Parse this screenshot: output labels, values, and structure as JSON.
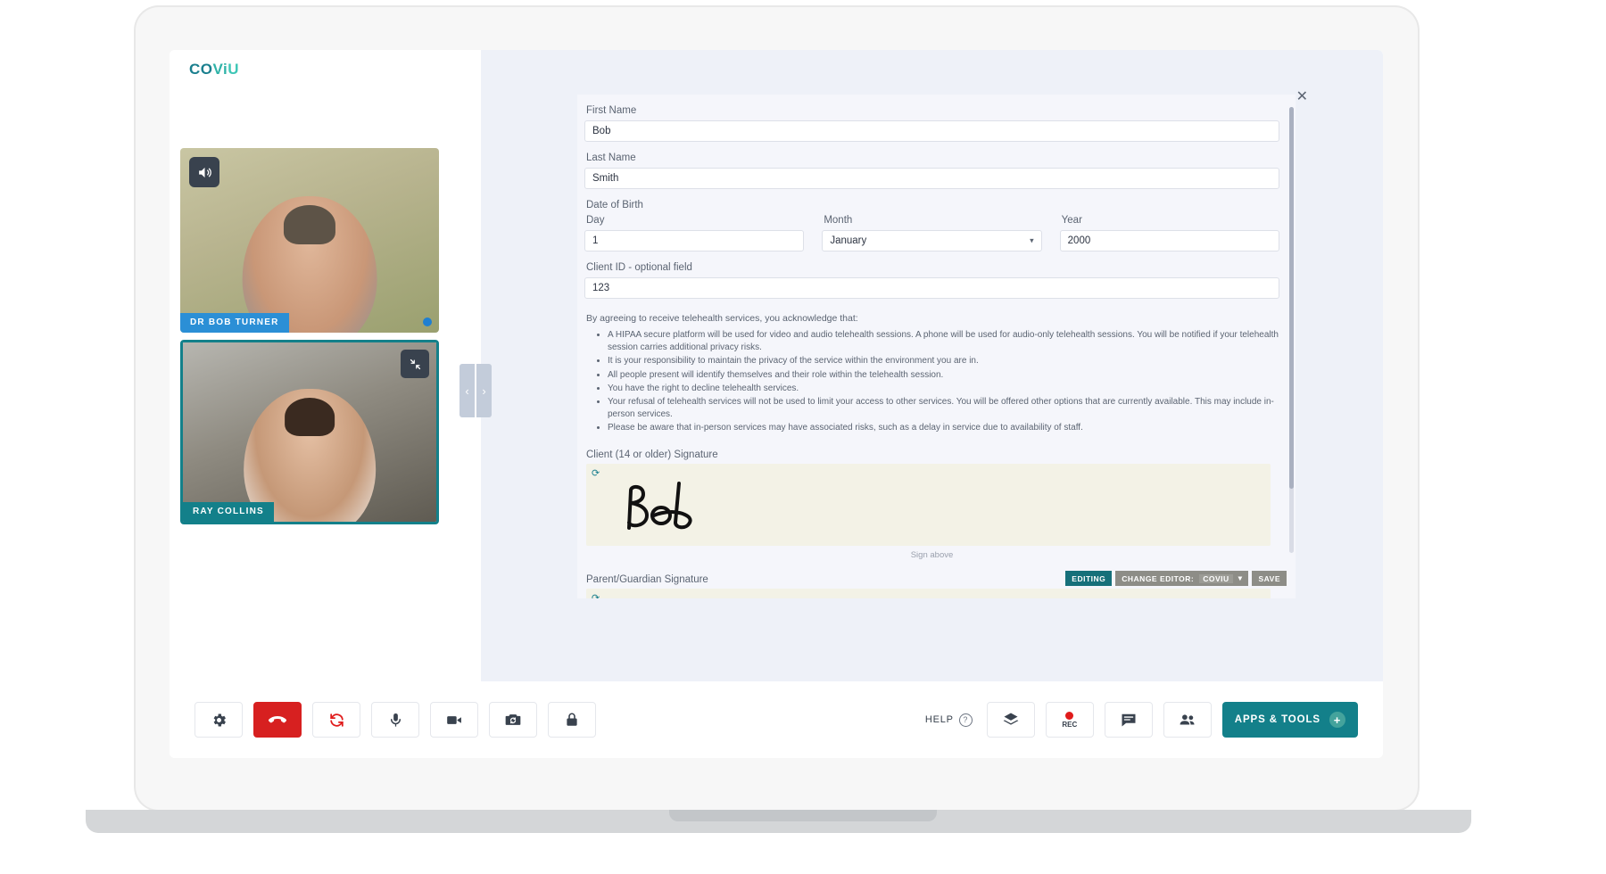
{
  "app": {
    "logo": {
      "part1": "CO",
      "part2": "Vi",
      "part3": "U"
    }
  },
  "video": {
    "remote": {
      "name": "DR BOB TURNER",
      "speaker_icon": "speaker-icon"
    },
    "local": {
      "name": "RAY COLLINS",
      "expand_icon": "collapse-icon"
    },
    "rail_prev": "‹",
    "rail_next": "›"
  },
  "form": {
    "close": "✕",
    "first_name": {
      "label": "First Name",
      "value": "Bob"
    },
    "last_name": {
      "label": "Last Name",
      "value": "Smith"
    },
    "dob": {
      "label": "Date of Birth",
      "day": {
        "label": "Day",
        "value": "1"
      },
      "month": {
        "label": "Month",
        "value": "January"
      },
      "year": {
        "label": "Year",
        "value": "2000"
      }
    },
    "client_id": {
      "label": "Client ID - optional field",
      "value": "123"
    },
    "consent_intro": "By agreeing to receive telehealth services, you acknowledge that:",
    "consent_items": [
      "A HIPAA secure platform will be used for video and audio telehealth sessions. A phone will be used for audio-only telehealth sessions. You will be notified if your telehealth session carries additional privacy risks.",
      "It is your responsibility to maintain the privacy of the service within the environment you are in.",
      "All people present will identify themselves and their role within the telehealth session.",
      "You have the right to decline telehealth services.",
      "Your refusal of telehealth services will not be used to limit your access to other services. You will be offered other options that are currently available. This may include in-person services.",
      "Please be aware that in-person services may have associated risks, such as a delay in service due to availability of staff."
    ],
    "client_signature": {
      "label": "Client (14 or older) Signature",
      "sign_hint": "Sign above",
      "reset_icon": "reset-icon"
    },
    "parent_signature": {
      "label": "Parent/Guardian Signature",
      "reset_icon": "reset-icon"
    },
    "toolbar": {
      "editing": "EDITING",
      "change_editor_label": "CHANGE EDITOR:",
      "change_editor_value": "COVIU",
      "save": "SAVE"
    }
  },
  "controls": {
    "left": [
      {
        "name": "settings-button",
        "icon": "gear-icon"
      },
      {
        "name": "hangup-button",
        "icon": "phone-hangup-icon"
      },
      {
        "name": "reconnect-button",
        "icon": "refresh-icon"
      },
      {
        "name": "microphone-button",
        "icon": "microphone-icon"
      },
      {
        "name": "camera-button",
        "icon": "video-camera-icon"
      },
      {
        "name": "flip-camera-button",
        "icon": "switch-camera-icon"
      },
      {
        "name": "lock-button",
        "icon": "lock-icon"
      }
    ],
    "help_label": "HELP",
    "right": [
      {
        "name": "layers-button",
        "icon": "layers-icon"
      },
      {
        "name": "record-button",
        "icon": "record-icon",
        "label": "REC"
      },
      {
        "name": "chat-button",
        "icon": "chat-icon"
      },
      {
        "name": "participants-button",
        "icon": "people-icon"
      }
    ],
    "apps_tools": "APPS & TOOLS",
    "apps_plus": "+"
  },
  "colors": {
    "teal": "#13808a",
    "danger": "#d72020",
    "blue_tag": "#2b8fd6",
    "panel_bg": "#eef1f8"
  }
}
